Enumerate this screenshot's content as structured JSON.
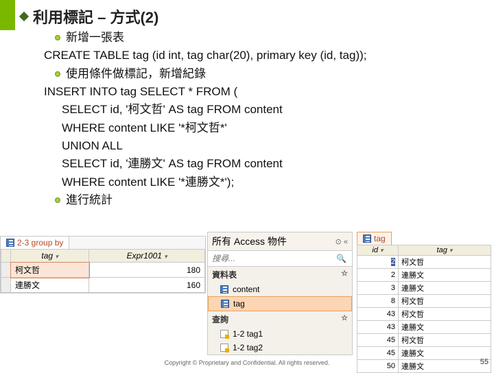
{
  "title": "利用標記 – 方式(2)",
  "bullets": {
    "b1": "新增一張表",
    "b2": "使用條件做標記，新增紀錄",
    "b3": "進行統計"
  },
  "code": {
    "l1": "CREATE TABLE tag (id int, tag char(20), primary key (id, tag));",
    "l2": "INSERT INTO tag SELECT * FROM (",
    "l3": "SELECT id, '柯文哲' AS tag FROM content",
    "l4": "WHERE content LIKE '*柯文哲*'",
    "l5": "UNION ALL",
    "l6": "SELECT id, '連勝文' AS tag FROM content",
    "l7": "WHERE content LIKE '*連勝文*');"
  },
  "shot1": {
    "tab": "2-3 group by",
    "col1": "tag",
    "col2": "Expr1001",
    "rows": [
      {
        "tag": "柯文哲",
        "val": "180"
      },
      {
        "tag": "連勝文",
        "val": "160"
      }
    ]
  },
  "shot2": {
    "header": "所有 Access 物件",
    "search_placeholder": "搜尋...",
    "sec_tables": "資料表",
    "item_content": "content",
    "item_tag": "tag",
    "sec_queries": "查詢",
    "q1": "1-2 tag1",
    "q2": "1-2 tag2"
  },
  "shot3": {
    "tab": "tag",
    "col_id": "id",
    "col_tag": "tag",
    "rows": [
      {
        "id": "2",
        "tag": "柯文哲",
        "hl": true
      },
      {
        "id": "2",
        "tag": "連勝文"
      },
      {
        "id": "3",
        "tag": "連勝文"
      },
      {
        "id": "8",
        "tag": "柯文哲"
      },
      {
        "id": "43",
        "tag": "柯文哲"
      },
      {
        "id": "43",
        "tag": "連勝文"
      },
      {
        "id": "45",
        "tag": "柯文哲"
      },
      {
        "id": "45",
        "tag": "連勝文"
      },
      {
        "id": "50",
        "tag": "連勝文"
      }
    ]
  },
  "footer": "Copyright © Proprietary and Confidential. All rights reserved.",
  "pageno": "55"
}
